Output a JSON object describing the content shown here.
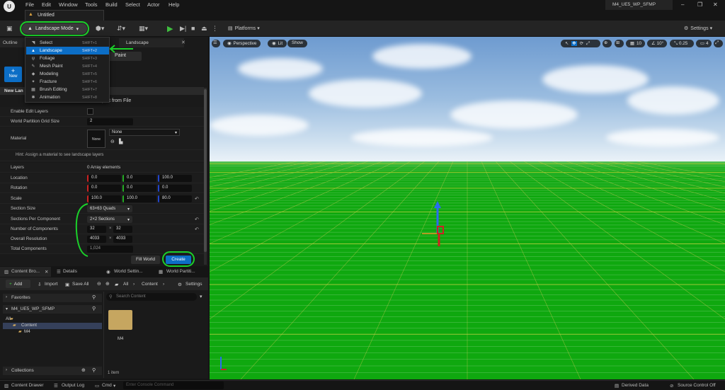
{
  "menubar": {
    "items": [
      "File",
      "Edit",
      "Window",
      "Tools",
      "Build",
      "Select",
      "Actor",
      "Help"
    ],
    "project_name": "M4_UE5_WP_SFMP",
    "logo_icon": "unreal-logo-icon"
  },
  "untitled_menu": {
    "label": "Untitled"
  },
  "toolbar": {
    "mode_label": "Landscape Mode",
    "platforms_label": "Platforms",
    "settings_label": "Settings"
  },
  "mode_menu": {
    "items": [
      {
        "label": "Select",
        "shortcut": "SHIFT+1"
      },
      {
        "label": "Landscape",
        "shortcut": "SHIFT+2"
      },
      {
        "label": "Foliage",
        "shortcut": "SHIFT+3"
      },
      {
        "label": "Mesh Paint",
        "shortcut": "SHIFT+4"
      },
      {
        "label": "Modeling",
        "shortcut": "SHIFT+5"
      },
      {
        "label": "Fracture",
        "shortcut": "SHIFT+6"
      },
      {
        "label": "Brush Editing",
        "shortcut": "SHIFT+7"
      },
      {
        "label": "Animation",
        "shortcut": "SHIFT+8"
      }
    ],
    "selected": "Landscape"
  },
  "left_panel": {
    "outliner_tab": "Outline",
    "landscape_tab": "Landscape",
    "paint_label": "Paint",
    "new_label": "New",
    "section_header": "New Lan",
    "import_label": "port from File",
    "properties": {
      "enable_edit_layers": "Enable Edit Layers",
      "world_partition_grid_size": {
        "label": "World Partition Grid Size",
        "value": "2"
      },
      "material": {
        "label": "Material",
        "thumb": "None",
        "combo": "None"
      },
      "hint": "Hint: Assign a material to see landscape layers",
      "layers": {
        "label": "Layers",
        "value": "0 Array elements"
      },
      "location": {
        "label": "Location",
        "x": "0.0",
        "y": "0.0",
        "z": "100.0"
      },
      "rotation": {
        "label": "Rotation",
        "x": "0.0",
        "y": "0.0",
        "z": "0.0"
      },
      "scale": {
        "label": "Scale",
        "x": "100.0",
        "y": "100.0",
        "z": "80.0"
      },
      "section_size": {
        "label": "Section Size",
        "value": "63×63 Quads"
      },
      "sections_per_component": {
        "label": "Sections Per Component",
        "value": "2×2 Sections"
      },
      "number_of_components": {
        "label": "Number of Components",
        "x": "32",
        "y": "32"
      },
      "overall_resolution": {
        "label": "Overall Resolution",
        "x": "4033",
        "y": "4033"
      },
      "total_components": {
        "label": "Total Components",
        "value": "1,024"
      }
    },
    "fill_world_label": "Fill World",
    "create_label": "Create"
  },
  "content_browser": {
    "tabs": [
      "Content Bro...",
      "Details",
      "World Settin...",
      "World Partiti..."
    ],
    "add_label": "Add",
    "import_label": "Import",
    "save_all_label": "Save All",
    "path": [
      "All",
      "Content"
    ],
    "settings_label": "Settings",
    "favorites_label": "Favorites",
    "project_label": "M4_UE5_WP_SFMP",
    "tree": [
      "All",
      "Content",
      "M4"
    ],
    "search_placeholder": "Search Content",
    "folder_label": "M4",
    "collections_label": "Collections",
    "item_count": "1 item"
  },
  "statusbar": {
    "content_drawer": "Content Drawer",
    "output_log": "Output Log",
    "cmd": "Cmd",
    "console_placeholder": "Enter Console Command",
    "derived_data": "Derived Data",
    "source_control": "Source Control Off"
  },
  "viewport": {
    "perspective_label": "Perspective",
    "lit_label": "Lit",
    "show_label": "Show",
    "grid_snap": "10",
    "rotation_snap": "10°",
    "scale_snap": "0.25",
    "camera_speed": "4"
  },
  "annotation_color": "#1bd12a",
  "accent_color": "#0c6ec6"
}
